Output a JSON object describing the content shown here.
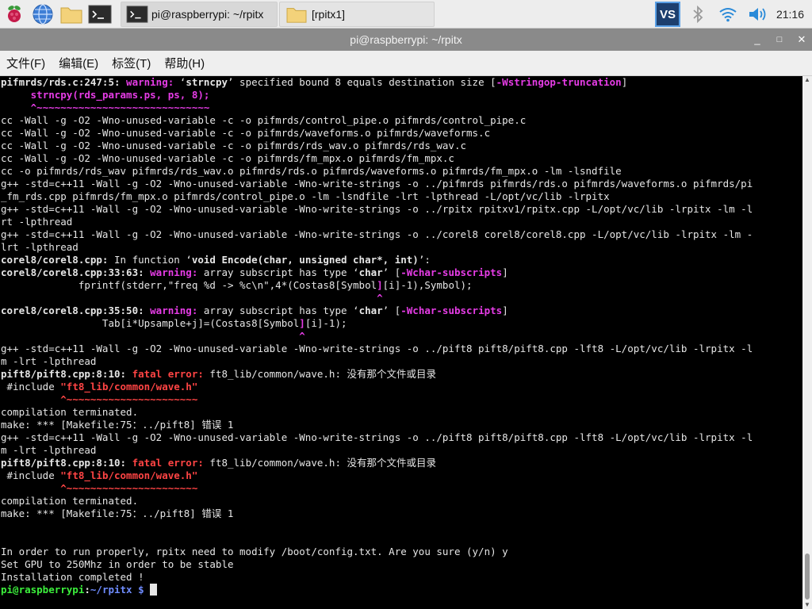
{
  "taskbar": {
    "tasks": [
      {
        "label": "pi@raspberrypi: ~/rpitx"
      },
      {
        "label": "[rpitx1]"
      }
    ],
    "clock": "21:16",
    "vnc_label": "VS"
  },
  "window": {
    "title": "pi@raspberrypi: ~/rpitx",
    "minimize": "_",
    "maximize": "□",
    "close": "✕"
  },
  "menu": {
    "items": [
      "文件(F)",
      "编辑(E)",
      "标签(T)",
      "帮助(H)"
    ]
  },
  "terminal": {
    "lines": [
      [
        {
          "c": "b",
          "t": "pifmrds/rds.c:247:5: "
        },
        {
          "c": "w",
          "t": "warning: "
        },
        {
          "c": "",
          "t": "‘"
        },
        {
          "c": "b",
          "t": "strncpy"
        },
        {
          "c": "",
          "t": "’ specified bound 8 equals destination size ["
        },
        {
          "c": "w",
          "t": "-Wstringop-truncation"
        },
        {
          "c": "",
          "t": "]"
        }
      ],
      [
        {
          "c": "",
          "t": "     "
        },
        {
          "c": "w",
          "t": "strncpy(rds_params.ps, ps, 8);"
        }
      ],
      [
        {
          "c": "",
          "t": "     "
        },
        {
          "c": "w",
          "t": "^~~~~~~~~~~~~~~~~~~~~~~~~~~~~~"
        }
      ],
      [
        {
          "c": "",
          "t": "cc -Wall -g -O2 -Wno-unused-variable -c -o pifmrds/control_pipe.o pifmrds/control_pipe.c"
        }
      ],
      [
        {
          "c": "",
          "t": "cc -Wall -g -O2 -Wno-unused-variable -c -o pifmrds/waveforms.o pifmrds/waveforms.c"
        }
      ],
      [
        {
          "c": "",
          "t": "cc -Wall -g -O2 -Wno-unused-variable -c -o pifmrds/rds_wav.o pifmrds/rds_wav.c"
        }
      ],
      [
        {
          "c": "",
          "t": "cc -Wall -g -O2 -Wno-unused-variable -c -o pifmrds/fm_mpx.o pifmrds/fm_mpx.c"
        }
      ],
      [
        {
          "c": "",
          "t": "cc -o pifmrds/rds_wav pifmrds/rds_wav.o pifmrds/rds.o pifmrds/waveforms.o pifmrds/fm_mpx.o -lm -lsndfile"
        }
      ],
      [
        {
          "c": "",
          "t": "g++ -std=c++11 -Wall -g -O2 -Wno-unused-variable -Wno-write-strings -o ../pifmrds pifmrds/rds.o pifmrds/waveforms.o pifmrds/pi"
        }
      ],
      [
        {
          "c": "",
          "t": "_fm_rds.cpp pifmrds/fm_mpx.o pifmrds/control_pipe.o -lm -lsndfile -lrt -lpthread -L/opt/vc/lib -lrpitx"
        }
      ],
      [
        {
          "c": "",
          "t": "g++ -std=c++11 -Wall -g -O2 -Wno-unused-variable -Wno-write-strings -o ../rpitx rpitxv1/rpitx.cpp -L/opt/vc/lib -lrpitx -lm -l"
        }
      ],
      [
        {
          "c": "",
          "t": "rt -lpthread"
        }
      ],
      [
        {
          "c": "",
          "t": "g++ -std=c++11 -Wall -g -O2 -Wno-unused-variable -Wno-write-strings -o ../corel8 corel8/corel8.cpp -L/opt/vc/lib -lrpitx -lm -"
        }
      ],
      [
        {
          "c": "",
          "t": "lrt -lpthread"
        }
      ],
      [
        {
          "c": "b",
          "t": "corel8/corel8.cpp:"
        },
        {
          "c": "",
          "t": " In function ‘"
        },
        {
          "c": "b",
          "t": "void Encode(char, unsigned char*, int)"
        },
        {
          "c": "",
          "t": "’:"
        }
      ],
      [
        {
          "c": "b",
          "t": "corel8/corel8.cpp:33:63: "
        },
        {
          "c": "w",
          "t": "warning: "
        },
        {
          "c": "",
          "t": "array subscript has type ‘"
        },
        {
          "c": "b",
          "t": "char"
        },
        {
          "c": "",
          "t": "’ ["
        },
        {
          "c": "w",
          "t": "-Wchar-subscripts"
        },
        {
          "c": "",
          "t": "]"
        }
      ],
      [
        {
          "c": "",
          "t": "             fprintf(stderr,\"freq %d -> %c\\n\",4*(Costas8[Symbol"
        },
        {
          "c": "w",
          "t": "]"
        },
        {
          "c": "",
          "t": "[i]-1),Symbol);"
        }
      ],
      [
        {
          "c": "",
          "t": "                                                               "
        },
        {
          "c": "w",
          "t": "^"
        }
      ],
      [
        {
          "c": "b",
          "t": "corel8/corel8.cpp:35:50: "
        },
        {
          "c": "w",
          "t": "warning: "
        },
        {
          "c": "",
          "t": "array subscript has type ‘"
        },
        {
          "c": "b",
          "t": "char"
        },
        {
          "c": "",
          "t": "’ ["
        },
        {
          "c": "w",
          "t": "-Wchar-subscripts"
        },
        {
          "c": "",
          "t": "]"
        }
      ],
      [
        {
          "c": "",
          "t": "                 Tab[i*Upsample+j]=(Costas8[Symbol"
        },
        {
          "c": "w",
          "t": "]"
        },
        {
          "c": "",
          "t": "[i]-1);"
        }
      ],
      [
        {
          "c": "",
          "t": "                                                  "
        },
        {
          "c": "w",
          "t": "^"
        }
      ],
      [
        {
          "c": "",
          "t": "g++ -std=c++11 -Wall -g -O2 -Wno-unused-variable -Wno-write-strings -o ../pift8 pift8/pift8.cpp -lft8 -L/opt/vc/lib -lrpitx -l"
        }
      ],
      [
        {
          "c": "",
          "t": "m -lrt -lpthread"
        }
      ],
      [
        {
          "c": "b",
          "t": "pift8/pift8.cpp:8:10: "
        },
        {
          "c": "e",
          "t": "fatal error: "
        },
        {
          "c": "",
          "t": "ft8_lib/common/wave.h: 没有那个文件或目录"
        }
      ],
      [
        {
          "c": "",
          "t": " #include "
        },
        {
          "c": "e",
          "t": "\"ft8_lib/common/wave.h\""
        }
      ],
      [
        {
          "c": "",
          "t": "          "
        },
        {
          "c": "e",
          "t": "^~~~~~~~~~~~~~~~~~~~~~~"
        }
      ],
      [
        {
          "c": "",
          "t": "compilation terminated."
        }
      ],
      [
        {
          "c": "",
          "t": "make: *** [Makefile:75：../pift8] 错误 1"
        }
      ],
      [
        {
          "c": "",
          "t": "g++ -std=c++11 -Wall -g -O2 -Wno-unused-variable -Wno-write-strings -o ../pift8 pift8/pift8.cpp -lft8 -L/opt/vc/lib -lrpitx -l"
        }
      ],
      [
        {
          "c": "",
          "t": "m -lrt -lpthread"
        }
      ],
      [
        {
          "c": "b",
          "t": "pift8/pift8.cpp:8:10: "
        },
        {
          "c": "e",
          "t": "fatal error: "
        },
        {
          "c": "",
          "t": "ft8_lib/common/wave.h: 没有那个文件或目录"
        }
      ],
      [
        {
          "c": "",
          "t": " #include "
        },
        {
          "c": "e",
          "t": "\"ft8_lib/common/wave.h\""
        }
      ],
      [
        {
          "c": "",
          "t": "          "
        },
        {
          "c": "e",
          "t": "^~~~~~~~~~~~~~~~~~~~~~~"
        }
      ],
      [
        {
          "c": "",
          "t": "compilation terminated."
        }
      ],
      [
        {
          "c": "",
          "t": "make: *** [Makefile:75：../pift8] 错误 1"
        }
      ],
      [
        {
          "c": "",
          "t": ""
        }
      ],
      [
        {
          "c": "",
          "t": ""
        }
      ],
      [
        {
          "c": "",
          "t": "In order to run properly, rpitx need to modify /boot/config.txt. Are you sure (y/n) y"
        }
      ],
      [
        {
          "c": "",
          "t": "Set GPU to 250Mhz in order to be stable"
        }
      ],
      [
        {
          "c": "",
          "t": "Installation completed !"
        }
      ]
    ],
    "prompt": {
      "user_host": "pi@raspberrypi",
      "sep": ":",
      "path": "~/rpitx",
      "symbol": " $ "
    }
  },
  "colors": {
    "warning": "#e63ce6",
    "error": "#ff4444",
    "prompt_user": "#3cf03c",
    "prompt_path": "#6f8cff",
    "titlebar": "#8a8a8a"
  }
}
